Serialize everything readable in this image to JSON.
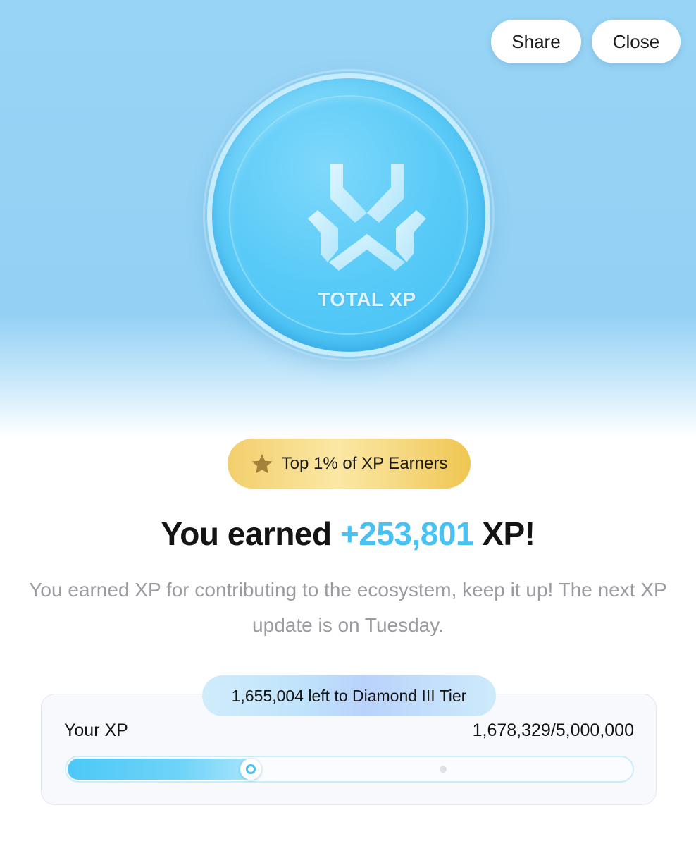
{
  "header": {
    "share_label": "Share",
    "close_label": "Close"
  },
  "coin": {
    "icon": "total-xp-logo",
    "label": "TOTAL XP"
  },
  "badge": {
    "icon": "star-icon",
    "label": "Top 1% of XP Earners"
  },
  "headline": {
    "prefix": "You earned",
    "amount": "+253,801",
    "suffix": "XP!"
  },
  "description": "You earned XP for contributing to the ecosystem, keep it up! The next XP update is on Tuesday.",
  "xp": {
    "tier_note": "1,655,004 left to Diamond III Tier",
    "label": "Your XP",
    "value_text": "1,678,329/5,000,000",
    "progress_fraction": 0.33
  },
  "colors": {
    "accent": "#47c2f2",
    "gold": "#f3cf6c",
    "hero_blue": "#93d0f4"
  }
}
